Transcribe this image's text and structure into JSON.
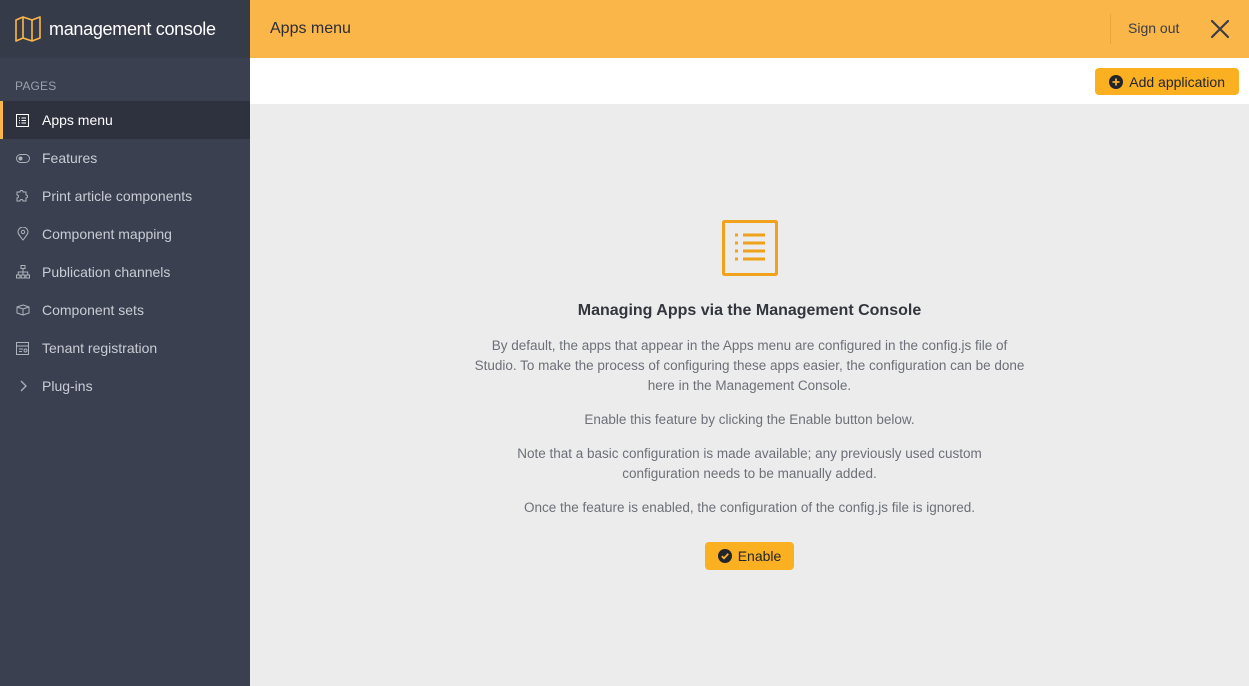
{
  "brand": {
    "name": "management console",
    "logo_icon": "map-icon"
  },
  "sidebar": {
    "section_label": "PAGES",
    "items": [
      {
        "label": "Apps menu",
        "icon": "list-icon",
        "active": true
      },
      {
        "label": "Features",
        "icon": "toggle-icon"
      },
      {
        "label": "Print article components",
        "icon": "puzzle-icon"
      },
      {
        "label": "Component mapping",
        "icon": "location-pin-icon"
      },
      {
        "label": "Publication channels",
        "icon": "sitemap-icon"
      },
      {
        "label": "Component sets",
        "icon": "box-icon"
      },
      {
        "label": "Tenant registration",
        "icon": "registration-icon"
      },
      {
        "label": "Plug-ins",
        "icon": "chevron-right-icon"
      }
    ]
  },
  "header": {
    "title": "Apps menu",
    "sign_out": "Sign out"
  },
  "toolbar": {
    "add_application": "Add application"
  },
  "main": {
    "heading": "Managing Apps via the Management Console",
    "para1": "By default, the apps that appear in the Apps menu are configured in the config.js file of Studio. To make the process of configuring these apps easier, the configuration can be done here in the Management Console.",
    "para2": "Enable this feature by clicking the Enable button below.",
    "para3": "Note that a basic configuration is made available; any previously used custom configuration needs to be manually added.",
    "para4": "Once the feature is enabled, the configuration of the config.js file is ignored.",
    "enable_label": "Enable"
  },
  "colors": {
    "accent": "#fbb64a",
    "button": "#fbb022",
    "sidebar": "#3a4050",
    "sidebar_active": "#2e323e"
  }
}
